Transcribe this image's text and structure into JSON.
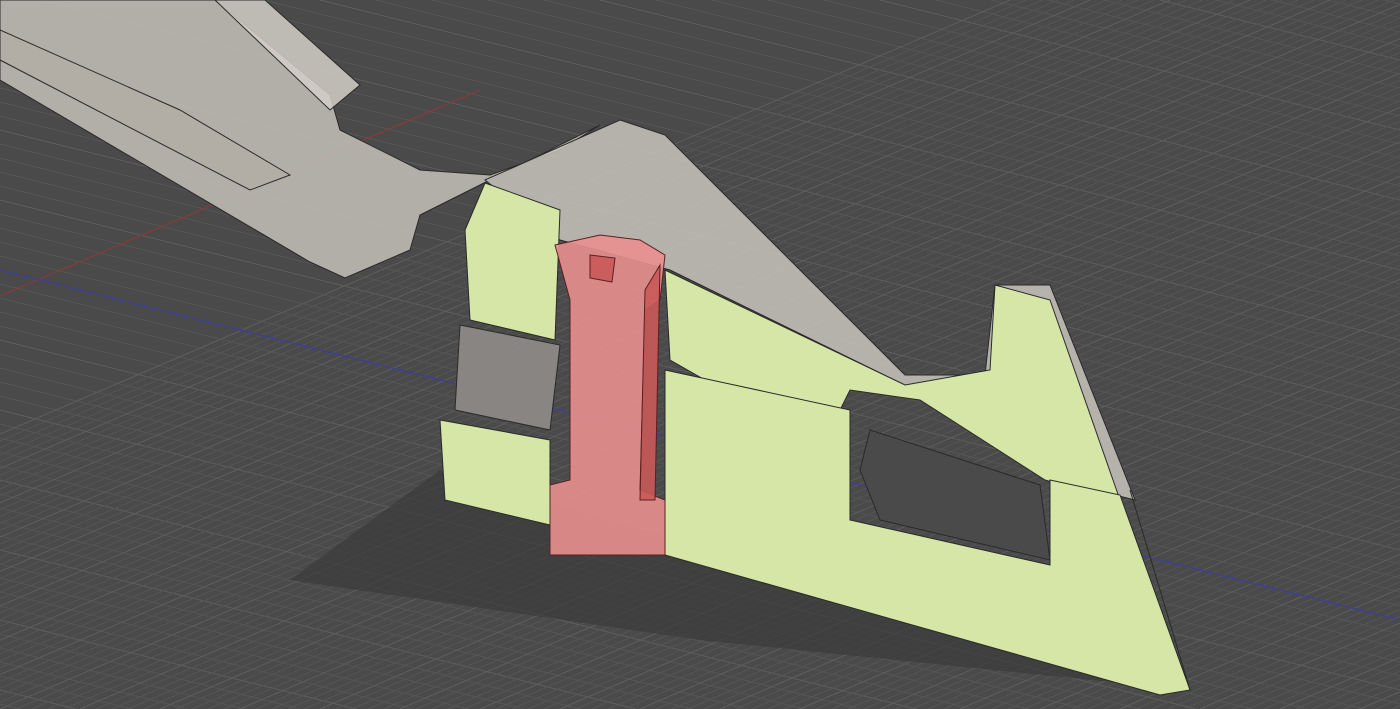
{
  "colors": {
    "background": "#4a4a4a",
    "grid_minor": "#555555",
    "grid_major": "#5e5e5e",
    "axis_x": "#8a3a3a",
    "axis_y": "#3c3f8e",
    "body_gray": "#c4c0b8",
    "section_green": "#d6e6a6",
    "section_red": "#e98f8f",
    "edge": "#2a2a2a"
  },
  "icons": [
    "cad-section-view"
  ]
}
